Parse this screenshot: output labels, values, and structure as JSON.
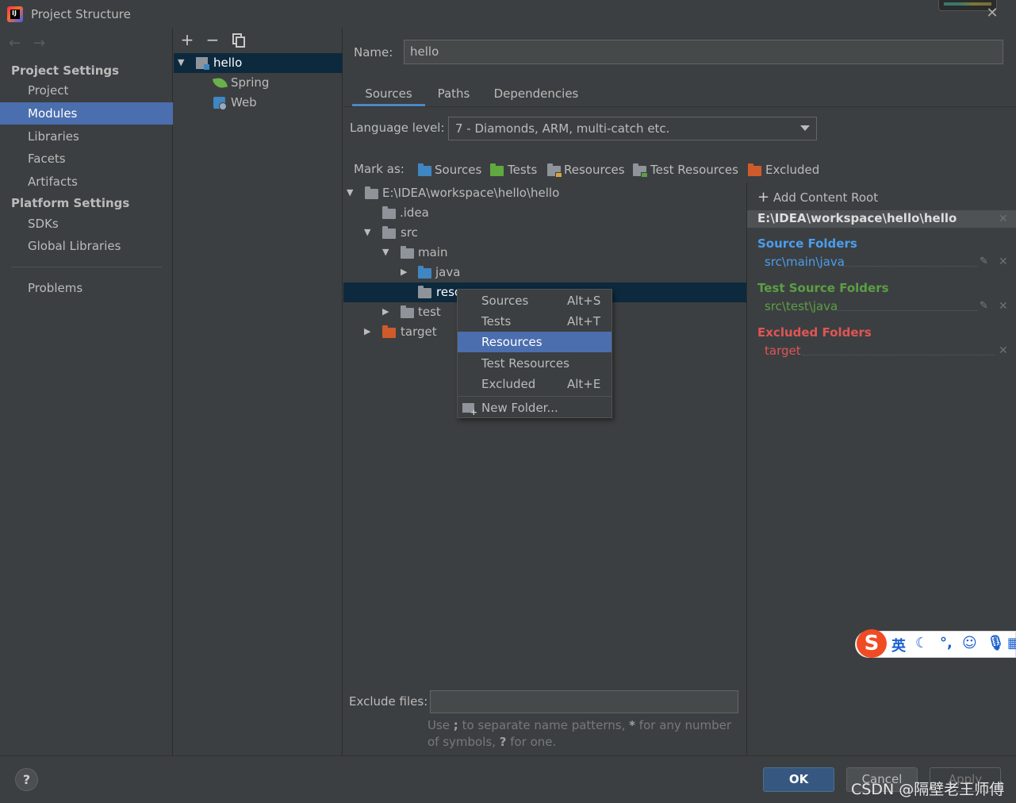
{
  "window": {
    "title": "Project Structure"
  },
  "sidebar": {
    "section1": "Project Settings",
    "items1": [
      "Project",
      "Modules",
      "Libraries",
      "Facets",
      "Artifacts"
    ],
    "section2": "Platform Settings",
    "items2": [
      "SDKs",
      "Global Libraries"
    ],
    "problems": "Problems"
  },
  "modules": {
    "root": "hello",
    "children": [
      "Spring",
      "Web"
    ]
  },
  "form": {
    "name_label": "Name:",
    "name_value": "hello",
    "tabs": [
      "Sources",
      "Paths",
      "Dependencies"
    ],
    "language_label": "Language level:",
    "language_value": "7 - Diamonds, ARM, multi-catch etc.",
    "mark_as_label": "Mark as:",
    "mark_as": [
      "Sources",
      "Tests",
      "Resources",
      "Test Resources",
      "Excluded"
    ]
  },
  "tree": {
    "root": "E:\\IDEA\\workspace\\hello\\hello",
    "idea": ".idea",
    "src": "src",
    "main": "main",
    "java": "java",
    "resources_truncated": "reso",
    "test": "test",
    "target": "target"
  },
  "context_menu": {
    "items": [
      {
        "label": "Sources",
        "shortcut": "Alt+S"
      },
      {
        "label": "Tests",
        "shortcut": "Alt+T"
      },
      {
        "label": "Resources",
        "shortcut": ""
      },
      {
        "label": "Test Resources",
        "shortcut": ""
      },
      {
        "label": "Excluded",
        "shortcut": "Alt+E"
      }
    ],
    "new_folder": "New Folder..."
  },
  "roots": {
    "add_content_root": "Add Content Root",
    "path": "E:\\IDEA\\workspace\\hello\\hello",
    "source_folders_title": "Source Folders",
    "source_folder": "src\\main\\java",
    "test_folders_title": "Test Source Folders",
    "test_folder": "src\\test\\java",
    "excluded_title": "Excluded Folders",
    "excluded_folder": "target"
  },
  "exclude": {
    "label": "Exclude files:",
    "hint_part1": "Use ",
    "hint_bold1": ";",
    "hint_part2": " to separate name patterns, ",
    "hint_bold2": "*",
    "hint_part3": " for any number of symbols, ",
    "hint_bold3": "?",
    "hint_part4": " for one."
  },
  "buttons": {
    "help": "?",
    "ok": "OK",
    "cancel": "Cancel",
    "apply": "Apply"
  },
  "watermark": "CSDN @隔壁老王师傅",
  "ime": {
    "logo": "S",
    "lang": "英"
  },
  "colors": {
    "accent": "#4b6eaf",
    "source": "#4a9eed",
    "test": "#5b9f44",
    "excluded": "#e05555",
    "tree_selection": "#0d293e"
  }
}
